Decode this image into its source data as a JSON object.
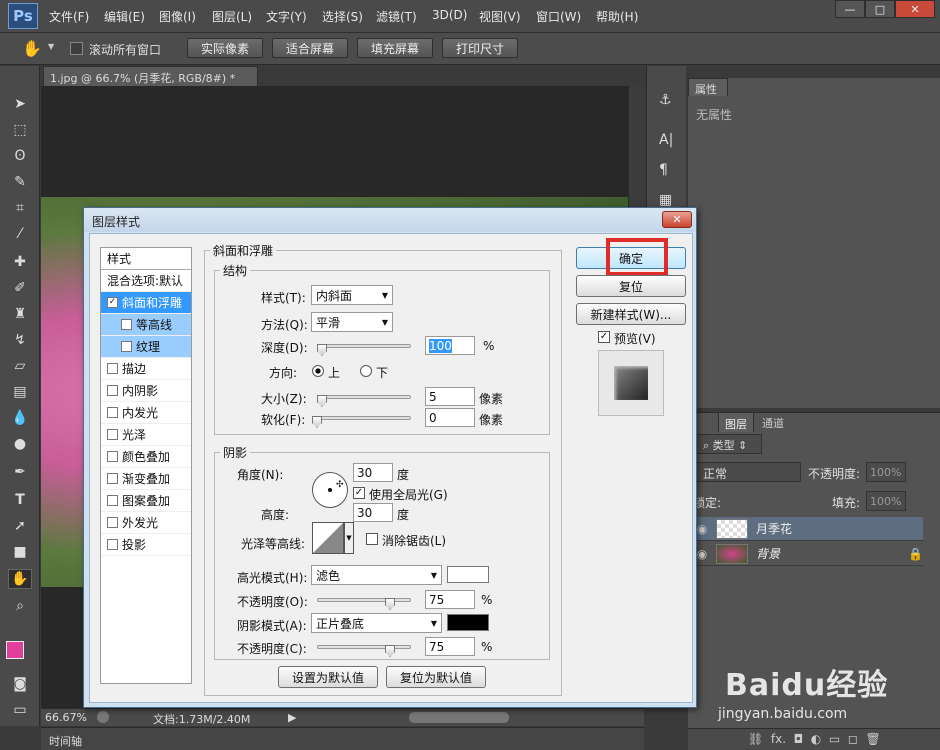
{
  "menubar": {
    "logo": "Ps",
    "items": [
      "文件(F)",
      "编辑(E)",
      "图像(I)",
      "图层(L)",
      "文字(Y)",
      "选择(S)",
      "滤镜(T)",
      "3D(D)",
      "视图(V)",
      "窗口(W)",
      "帮助(H)"
    ],
    "min": "—",
    "max": "□",
    "close": "✕"
  },
  "options": {
    "scroll_all": "滚动所有窗口",
    "actual_pixels": "实际像素",
    "fit_screen": "适合屏幕",
    "fill_screen": "填充屏幕",
    "print_size": "打印尺寸"
  },
  "document": {
    "tab": "1.jpg @ 66.7% (月季花, RGB/8#) *",
    "tab_close": "×",
    "zoom": "66.67%",
    "doc_info": "文档:1.73M/2.40M",
    "timeline": "时间轴"
  },
  "properties": {
    "tab": "属性",
    "empty": "无属性"
  },
  "layers": {
    "tabs": [
      "图层",
      "通道"
    ],
    "kind": "类型",
    "blend": "正常",
    "opacity_label": "不透明度:",
    "opacity_value": "100%",
    "lock_label": "锁定:",
    "fill_label": "填充:",
    "fill_value": "100%",
    "items": [
      {
        "name": "月季花"
      },
      {
        "name": "背景"
      }
    ]
  },
  "dialog": {
    "title": "图层样式",
    "close": "✕",
    "styles_header": "样式",
    "blend_options": "混合选项:默认",
    "styles": [
      "斜面和浮雕",
      "等高线",
      "纹理",
      "描边",
      "内阴影",
      "内发光",
      "光泽",
      "颜色叠加",
      "渐变叠加",
      "图案叠加",
      "外发光",
      "投影"
    ],
    "bevel_title": "斜面和浮雕",
    "structure": {
      "title": "结构",
      "style_label": "样式(T):",
      "style_value": "内斜面",
      "technique_label": "方法(Q):",
      "technique_value": "平滑",
      "depth_label": "深度(D):",
      "depth_value": "100",
      "depth_unit": "%",
      "depth_slider": 1.0,
      "direction_label": "方向:",
      "dir_up": "上",
      "dir_down": "下",
      "size_label": "大小(Z):",
      "size_value": "5",
      "size_unit": "像素",
      "size_slider": 0.02,
      "soften_label": "软化(F):",
      "soften_value": "0",
      "soften_unit": "像素",
      "soften_slider": 0.0
    },
    "shading": {
      "title": "阴影",
      "angle_label": "角度(N):",
      "angle_value": "30",
      "angle_unit": "度",
      "global_light": "使用全局光(G)",
      "altitude_label": "高度:",
      "altitude_value": "30",
      "altitude_unit": "度",
      "gloss_label": "光泽等高线:",
      "anti_alias": "消除锯齿(L)",
      "highlight_label": "高光模式(H):",
      "highlight_value": "滤色",
      "highlight_color": "#ffffff",
      "hl_opacity_label": "不透明度(O):",
      "hl_opacity_value": "75",
      "hl_opacity_unit": "%",
      "shadow_label": "阴影模式(A):",
      "shadow_value": "正片叠底",
      "shadow_color": "#000000",
      "sh_opacity_label": "不透明度(C):",
      "sh_opacity_value": "75",
      "sh_opacity_unit": "%"
    },
    "set_default": "设置为默认值",
    "reset_default": "复位为默认值",
    "ok": "确定",
    "reset": "复位",
    "new_style": "新建样式(W)...",
    "preview": "预览(V)"
  },
  "watermark": {
    "brand": "Baidu经验",
    "url": "jingyan.baidu.com"
  }
}
